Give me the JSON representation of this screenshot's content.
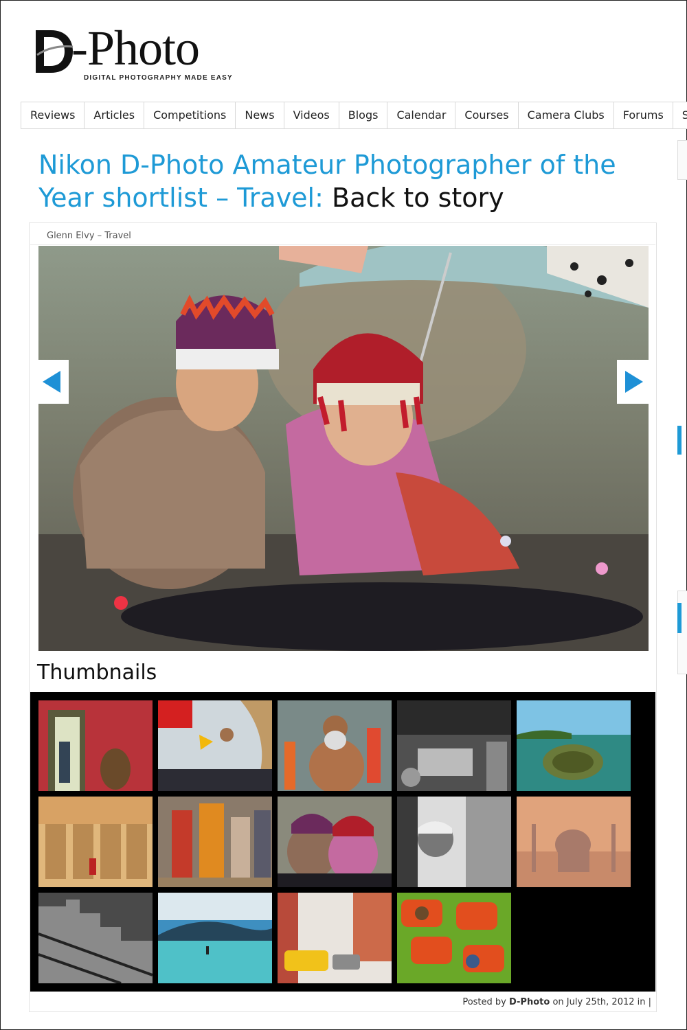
{
  "logo": {
    "wordmark": "D-Photo",
    "letter_d": "D",
    "wordmark_rest": "-Photo",
    "tagline": "DIGITAL PHOTOGRAPHY MADE EASY"
  },
  "nav": {
    "items": [
      {
        "label": "Reviews"
      },
      {
        "label": "Articles"
      },
      {
        "label": "Competitions"
      },
      {
        "label": "News"
      },
      {
        "label": "Videos"
      },
      {
        "label": "Blogs"
      },
      {
        "label": "Calendar"
      },
      {
        "label": "Courses"
      },
      {
        "label": "Camera Clubs"
      },
      {
        "label": "Forums"
      },
      {
        "label": "Sh"
      }
    ]
  },
  "title": {
    "text": "Nikon D-Photo Amateur Photographer of the Year shortlist – Travel:",
    "back_link": "Back to story"
  },
  "gallery": {
    "caption": "Glenn Elvy – Travel",
    "prev_icon": "arrow-left-icon",
    "next_icon": "arrow-right-icon",
    "thumbnails_heading": "Thumbnails",
    "thumbnails": [
      {
        "subject": "child in doorway with birdcage"
      },
      {
        "subject": "flags on boat"
      },
      {
        "subject": "sadhu on street"
      },
      {
        "subject": "black and white kitchen"
      },
      {
        "subject": "sea turtle split view"
      },
      {
        "subject": "abu simbel temple"
      },
      {
        "subject": "robed monks"
      },
      {
        "subject": "children in hats"
      },
      {
        "subject": "black and white child peeking"
      },
      {
        "subject": "taj mahal at dusk"
      },
      {
        "subject": "great wall black and white"
      },
      {
        "subject": "lake and mountain"
      },
      {
        "subject": "yellow taxi street"
      },
      {
        "subject": "children in red tubs"
      }
    ]
  },
  "footer": {
    "posted_prefix": "Posted by",
    "author": "D-Photo",
    "date_text": "on July 25th, 2012 in |"
  },
  "colors": {
    "accent": "#1e9ad6",
    "text": "#111111"
  }
}
